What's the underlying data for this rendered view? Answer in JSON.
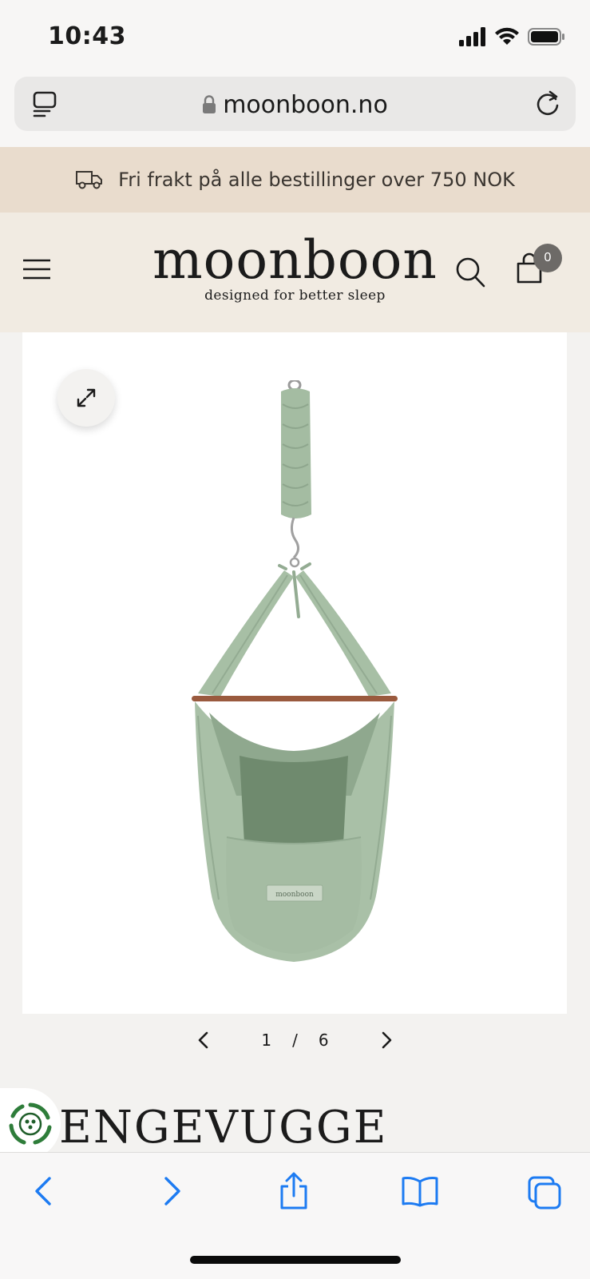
{
  "status_bar": {
    "time": "10:43"
  },
  "browser": {
    "url": "moonboon.no"
  },
  "promo": {
    "text": "Fri frakt på alle bestillinger over 750 NOK"
  },
  "header": {
    "logo": "moonboon",
    "tagline": "designed for better sleep",
    "cart_count": "0"
  },
  "gallery": {
    "current": "1",
    "separator": "/",
    "total": "6",
    "product_label": "moonboon"
  },
  "product": {
    "title": "ENGEVUGGE"
  },
  "colors": {
    "promo_bg": "#e9dccd",
    "header_bg": "#f1ebe2",
    "fabric": "#a7bfa5",
    "browser_accent": "#1d7bf2",
    "eco_green": "#2e7d3a"
  },
  "icons": [
    "signal-icon",
    "wifi-icon",
    "battery-icon",
    "tabs-overview-icon",
    "lock-icon",
    "reload-icon",
    "truck-icon",
    "hamburger-menu-icon",
    "search-icon",
    "cart-icon",
    "expand-icon",
    "chevron-left-icon",
    "chevron-right-icon",
    "eco-recycle-icon",
    "back-icon",
    "forward-icon",
    "share-icon",
    "bookmarks-icon",
    "tabs-icon"
  ]
}
